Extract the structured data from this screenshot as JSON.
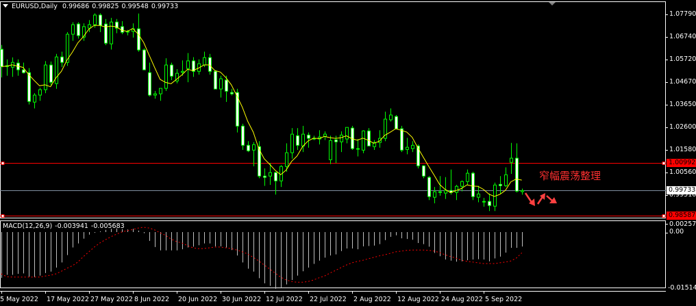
{
  "header": {
    "symbol_timeframe": "EURUSD,Daily",
    "open": "0.99686",
    "high": "0.99825",
    "low": "0.99548",
    "close": "0.99733"
  },
  "macd_header": {
    "label": "MACD(12,26,9)",
    "main": "-0.003941",
    "signal": "-0.005683"
  },
  "annotation": "窄幅震荡整理",
  "price_axis": [
    "1.07790",
    "1.06740",
    "1.05720",
    "1.04670",
    "1.03650",
    "1.02600",
    "1.01580",
    "1.00560",
    "0.99510"
  ],
  "macd_axis": [
    "0.002572",
    "0.00",
    "-0.015148"
  ],
  "price_tags": {
    "resistance": "1.00992",
    "current": "0.99733",
    "support": "0.98587"
  },
  "colors": {
    "background": "#000000",
    "candle_outline": "#00ff00",
    "bear_fill": "#ffffff",
    "bull_fill": "#000000",
    "ma_line": "#ffff00",
    "level_line": "#ff0000",
    "bid_line": "#8090a0",
    "macd_hist": "#c0c0c0",
    "macd_signal": "#ff0000",
    "annotation": "#ff3030"
  },
  "chart_data": {
    "type": "candlestick",
    "symbol": "EURUSD",
    "timeframe": "Daily",
    "ylim": [
      0.9843,
      1.0847
    ],
    "date_labels": [
      {
        "index": 0,
        "label": "5 May 2022"
      },
      {
        "index": 8,
        "label": "17 May 2022"
      },
      {
        "index": 16,
        "label": "27 May 2022"
      },
      {
        "index": 24,
        "label": "8 Jun 2022"
      },
      {
        "index": 32,
        "label": "20 Jun 2022"
      },
      {
        "index": 40,
        "label": "30 Jun 2022"
      },
      {
        "index": 48,
        "label": "12 Jul 2022"
      },
      {
        "index": 56,
        "label": "22 Jul 2022"
      },
      {
        "index": 64,
        "label": "2 Aug 2022"
      },
      {
        "index": 72,
        "label": "12 Aug 2022"
      },
      {
        "index": 80,
        "label": "24 Aug 2022"
      },
      {
        "index": 88,
        "label": "5 Sep 2022"
      }
    ],
    "horizontal_levels": [
      {
        "name": "resistance",
        "price": 1.00992
      },
      {
        "name": "support",
        "price": 0.98587
      },
      {
        "name": "bid",
        "price": 0.99733
      }
    ],
    "ohlc": [
      [
        1.0621,
        1.0641,
        1.0492,
        1.0542
      ],
      [
        1.0542,
        1.0575,
        1.05,
        1.0546
      ],
      [
        1.0539,
        1.0584,
        1.0495,
        1.0561
      ],
      [
        1.0558,
        1.0575,
        1.05,
        1.0527
      ],
      [
        1.0527,
        1.056,
        1.051,
        1.0514
      ],
      [
        1.0514,
        1.0535,
        1.0368,
        1.0382
      ],
      [
        1.0379,
        1.042,
        1.035,
        1.0411
      ],
      [
        1.0411,
        1.0445,
        1.0385,
        1.0436
      ],
      [
        1.0436,
        1.0567,
        1.042,
        1.0549
      ],
      [
        1.0549,
        1.0565,
        1.0455,
        1.047
      ],
      [
        1.0464,
        1.06,
        1.044,
        1.0586
      ],
      [
        1.0586,
        1.061,
        1.054,
        1.0561
      ],
      [
        1.0561,
        1.07,
        1.0545,
        1.069
      ],
      [
        1.069,
        1.0745,
        1.066,
        1.0734
      ],
      [
        1.0737,
        1.0745,
        1.067,
        1.0684
      ],
      [
        1.0677,
        1.074,
        1.066,
        1.0725
      ],
      [
        1.0718,
        1.0755,
        1.07,
        1.0734
      ],
      [
        1.0734,
        1.0786,
        1.072,
        1.0778
      ],
      [
        1.0778,
        1.0786,
        1.07,
        1.0731
      ],
      [
        1.0737,
        1.076,
        1.064,
        1.0649
      ],
      [
        1.0646,
        1.0765,
        1.062,
        1.0746
      ],
      [
        1.0746,
        1.076,
        1.0695,
        1.0718
      ],
      [
        1.0725,
        1.075,
        1.069,
        1.0699
      ],
      [
        1.0703,
        1.071,
        1.0685,
        1.0703
      ],
      [
        1.0703,
        1.074,
        1.0675,
        1.0715
      ],
      [
        1.0715,
        1.0785,
        1.061,
        1.0618
      ],
      [
        1.0618,
        1.0625,
        1.0525,
        1.0527
      ],
      [
        1.0514,
        1.056,
        1.0405,
        1.0411
      ],
      [
        1.0411,
        1.043,
        1.0395,
        1.0417
      ],
      [
        1.0417,
        1.044,
        1.0385,
        1.0442
      ],
      [
        1.0442,
        1.058,
        1.043,
        1.0549
      ],
      [
        1.0549,
        1.056,
        1.048,
        1.0498
      ],
      [
        1.0476,
        1.053,
        1.0465,
        1.0511
      ],
      [
        1.0515,
        1.057,
        1.05,
        1.052
      ],
      [
        1.0533,
        1.0604,
        1.047,
        1.0568
      ],
      [
        1.0568,
        1.0585,
        1.0495,
        1.052
      ],
      [
        1.052,
        1.0575,
        1.0505,
        1.0555
      ],
      [
        1.0549,
        1.061,
        1.054,
        1.0583
      ],
      [
        1.0583,
        1.06,
        1.0505,
        1.052
      ],
      [
        1.052,
        1.0525,
        1.044,
        1.0439
      ],
      [
        1.0439,
        1.05,
        1.04,
        1.0486
      ],
      [
        1.048,
        1.05,
        1.038,
        1.0429
      ],
      [
        1.0423,
        1.044,
        1.041,
        1.0417
      ],
      [
        1.0423,
        1.044,
        1.024,
        1.0269
      ],
      [
        1.0269,
        1.028,
        1.016,
        1.0181
      ],
      [
        1.0181,
        1.02,
        1.015,
        1.0156
      ],
      [
        1.0159,
        1.0195,
        1.0085,
        1.0184
      ],
      [
        1.0175,
        1.02,
        1.003,
        1.004
      ],
      [
        1.004,
        1.0075,
        0.9995,
        1.0034
      ],
      [
        1.004,
        1.01,
        1.0,
        1.0056
      ],
      [
        1.0056,
        1.006,
        0.9955,
        1.0018
      ],
      [
        1.0018,
        1.009,
        0.999,
        1.0084
      ],
      [
        1.0084,
        1.019,
        1.006,
        1.0147
      ],
      [
        1.0147,
        1.026,
        1.012,
        1.0232
      ],
      [
        1.0225,
        1.026,
        1.016,
        1.0181
      ],
      [
        1.0178,
        1.027,
        1.015,
        1.0232
      ],
      [
        1.0228,
        1.024,
        1.017,
        1.0213
      ],
      [
        1.0213,
        1.0225,
        1.0205,
        1.0213
      ],
      [
        1.021,
        1.025,
        1.0185,
        1.0219
      ],
      [
        1.0222,
        1.0245,
        1.0205,
        1.0232
      ],
      [
        1.0115,
        1.0225,
        1.0095,
        1.0203
      ],
      [
        1.0206,
        1.0225,
        1.01,
        1.0197
      ],
      [
        1.0197,
        1.0245,
        1.015,
        1.0228
      ],
      [
        1.021,
        1.026,
        1.019,
        1.0263
      ],
      [
        1.026,
        1.027,
        1.016,
        1.0166
      ],
      [
        1.0166,
        1.021,
        1.013,
        1.0166
      ],
      [
        1.0159,
        1.025,
        1.0145,
        1.0247
      ],
      [
        1.0247,
        1.026,
        1.0185,
        1.0178
      ],
      [
        1.0175,
        1.0205,
        1.016,
        1.0194
      ],
      [
        1.0194,
        1.025,
        1.017,
        1.0213
      ],
      [
        1.0213,
        1.0335,
        1.02,
        1.0301
      ],
      [
        1.0298,
        1.035,
        1.029,
        1.032
      ],
      [
        1.0313,
        1.032,
        1.027,
        1.0257
      ],
      [
        1.0257,
        1.027,
        1.015,
        1.0159
      ],
      [
        1.0162,
        1.0215,
        1.014,
        1.0172
      ],
      [
        1.0166,
        1.02,
        1.015,
        1.0181
      ],
      [
        1.0178,
        1.0185,
        1.0075,
        1.0087
      ],
      [
        1.0087,
        1.009,
        1.003,
        1.004
      ],
      [
        1.0034,
        1.004,
        0.993,
        0.9946
      ],
      [
        0.9943,
        0.999,
        0.9915,
        0.9968
      ],
      [
        0.9968,
        1.004,
        0.995,
        0.9968
      ],
      [
        0.9962,
        1.0035,
        0.9935,
        0.9974
      ],
      [
        0.9974,
        1.007,
        0.9955,
        0.9965
      ],
      [
        0.9965,
        1.0,
        0.993,
        0.9993
      ],
      [
        0.9993,
        1.002,
        0.997,
        1.0015
      ],
      [
        1.0015,
        1.007,
        1.0,
        1.0053
      ],
      [
        1.0053,
        1.006,
        0.993,
        0.9946
      ],
      [
        0.9943,
        0.9995,
        0.992,
        0.9958
      ],
      [
        0.9924,
        0.994,
        0.99,
        0.9924
      ],
      [
        0.9924,
        0.996,
        0.988,
        0.9905
      ],
      [
        0.9902,
        1.001,
        0.988,
        0.9999
      ],
      [
        1.0002,
        1.004,
        0.996,
        0.9996
      ],
      [
        0.9996,
        1.008,
        0.999,
        1.0046
      ],
      [
        1.0103,
        1.0192,
        1.005,
        1.0122
      ],
      [
        1.0122,
        1.019,
        0.9965,
        0.9971
      ],
      [
        0.99686,
        0.99825,
        0.99548,
        0.99733
      ]
    ],
    "macd": {
      "ylim": [
        -0.015148,
        0.0032
      ],
      "histogram": [
        -0.0125,
        -0.0117,
        -0.0117,
        -0.0114,
        -0.0113,
        -0.0122,
        -0.0123,
        -0.0119,
        -0.0112,
        -0.0108,
        -0.0097,
        -0.0083,
        -0.0063,
        -0.0042,
        -0.0031,
        -0.0018,
        -0.0007,
        -0.0002,
        0.0002,
        0.0006,
        0.0009,
        0.001,
        0.0008,
        0.0007,
        0.0009,
        0.0004,
        -0.0003,
        -0.0024,
        -0.0041,
        -0.005,
        -0.005,
        -0.005,
        -0.005,
        -0.0047,
        -0.0042,
        -0.004,
        -0.0036,
        -0.0031,
        -0.0031,
        -0.0039,
        -0.0039,
        -0.0042,
        -0.0049,
        -0.0064,
        -0.0083,
        -0.01,
        -0.0108,
        -0.0126,
        -0.014,
        -0.0147,
        -0.0155,
        -0.0151,
        -0.0143,
        -0.0131,
        -0.0119,
        -0.0107,
        -0.0097,
        -0.0087,
        -0.0078,
        -0.007,
        -0.0064,
        -0.0061,
        -0.0052,
        -0.0045,
        -0.0045,
        -0.0047,
        -0.0039,
        -0.0038,
        -0.0037,
        -0.0033,
        -0.0022,
        -0.0013,
        -0.0009,
        -0.0017,
        -0.0019,
        -0.0021,
        -0.003,
        -0.0033,
        -0.004,
        -0.0057,
        -0.0066,
        -0.0075,
        -0.0078,
        -0.0081,
        -0.008,
        -0.0077,
        -0.0075,
        -0.0074,
        -0.0075,
        -0.008,
        -0.0072,
        -0.0067,
        -0.0056,
        -0.0043,
        -0.0043,
        -0.003941
      ],
      "signal": [
        -0.0114,
        -0.0122,
        -0.0123,
        -0.0123,
        -0.0123,
        -0.0123,
        -0.0123,
        -0.0123,
        -0.012,
        -0.0118,
        -0.0114,
        -0.0107,
        -0.0099,
        -0.0092,
        -0.0082,
        -0.0067,
        -0.0054,
        -0.0041,
        -0.003,
        -0.0021,
        -0.0013,
        -0.0006,
        0.0,
        0.0004,
        0.0007,
        0.0011,
        0.0013,
        0.0011,
        0.0006,
        -0.0002,
        -0.0009,
        -0.0019,
        -0.0026,
        -0.003,
        -0.0037,
        -0.0043,
        -0.0045,
        -0.0045,
        -0.0043,
        -0.0041,
        -0.0041,
        -0.0043,
        -0.0045,
        -0.0049,
        -0.0054,
        -0.006,
        -0.0069,
        -0.0079,
        -0.009,
        -0.0101,
        -0.0112,
        -0.0123,
        -0.0131,
        -0.0135,
        -0.0137,
        -0.0137,
        -0.0135,
        -0.0131,
        -0.0125,
        -0.012,
        -0.0112,
        -0.0105,
        -0.0097,
        -0.009,
        -0.0084,
        -0.008,
        -0.0077,
        -0.0073,
        -0.0069,
        -0.0065,
        -0.0062,
        -0.0058,
        -0.0054,
        -0.0052,
        -0.005,
        -0.0049,
        -0.0049,
        -0.0049,
        -0.005,
        -0.0052,
        -0.0056,
        -0.0062,
        -0.0067,
        -0.0071,
        -0.0077,
        -0.008,
        -0.0082,
        -0.0084,
        -0.0086,
        -0.0086,
        -0.0086,
        -0.0084,
        -0.0082,
        -0.0079,
        -0.0071,
        -0.005683
      ]
    }
  }
}
